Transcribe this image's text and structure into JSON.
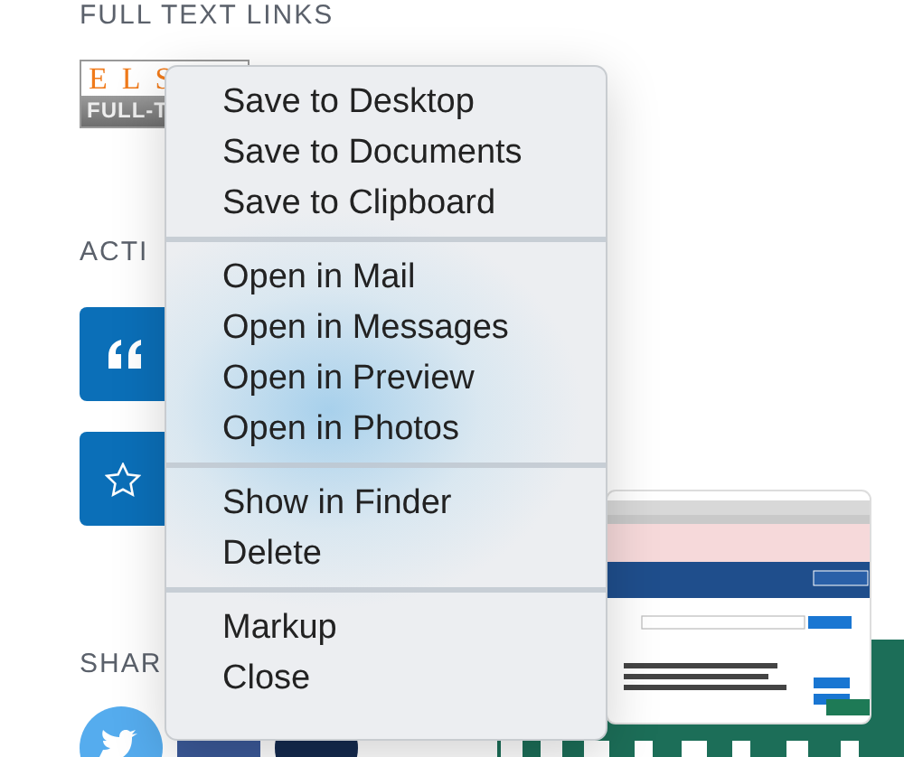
{
  "page": {
    "full_text_heading": "FULL TEXT LINKS",
    "logo": {
      "top": "ELS",
      "bottom": "FULL-T"
    },
    "actions_heading": "ACTI",
    "action_buttons": [
      {
        "kind": "cite"
      },
      {
        "kind": "favorite"
      }
    ],
    "share_heading": "SHAR",
    "share_icons": [
      {
        "kind": "twitter"
      },
      {
        "kind": "facebook"
      },
      {
        "kind": "other"
      }
    ]
  },
  "context_menu": {
    "groups": [
      [
        "Save to Desktop",
        "Save to Documents",
        "Save to Clipboard"
      ],
      [
        "Open in Mail",
        "Open in Messages",
        "Open in Preview",
        "Open in Photos"
      ],
      [
        "Show in Finder",
        "Delete"
      ],
      [
        "Markup",
        "Close"
      ]
    ]
  },
  "screenshot_thumbnail": {
    "kind": "screenshot"
  }
}
